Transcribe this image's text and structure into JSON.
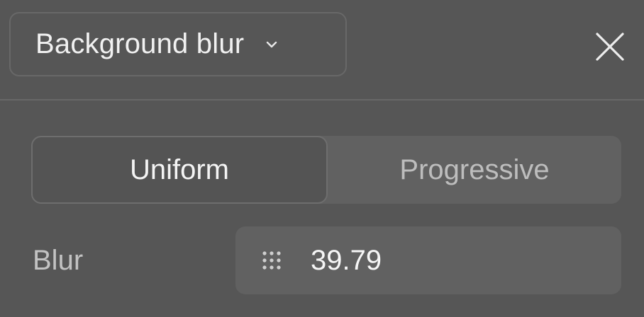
{
  "effect": {
    "selected": "Background blur",
    "dropdown_icon": "chevron-down-icon",
    "close_icon": "close-icon"
  },
  "mode_toggle": {
    "options": [
      "Uniform",
      "Progressive"
    ],
    "selected": "Uniform"
  },
  "blur": {
    "label": "Blur",
    "value": "39.79",
    "handle_icon": "drag-dots-icon"
  },
  "colors": {
    "panel_bg": "#565656",
    "field_bg": "#616161",
    "text_primary": "#f1f1f1",
    "text_secondary": "#bdbdbd"
  }
}
